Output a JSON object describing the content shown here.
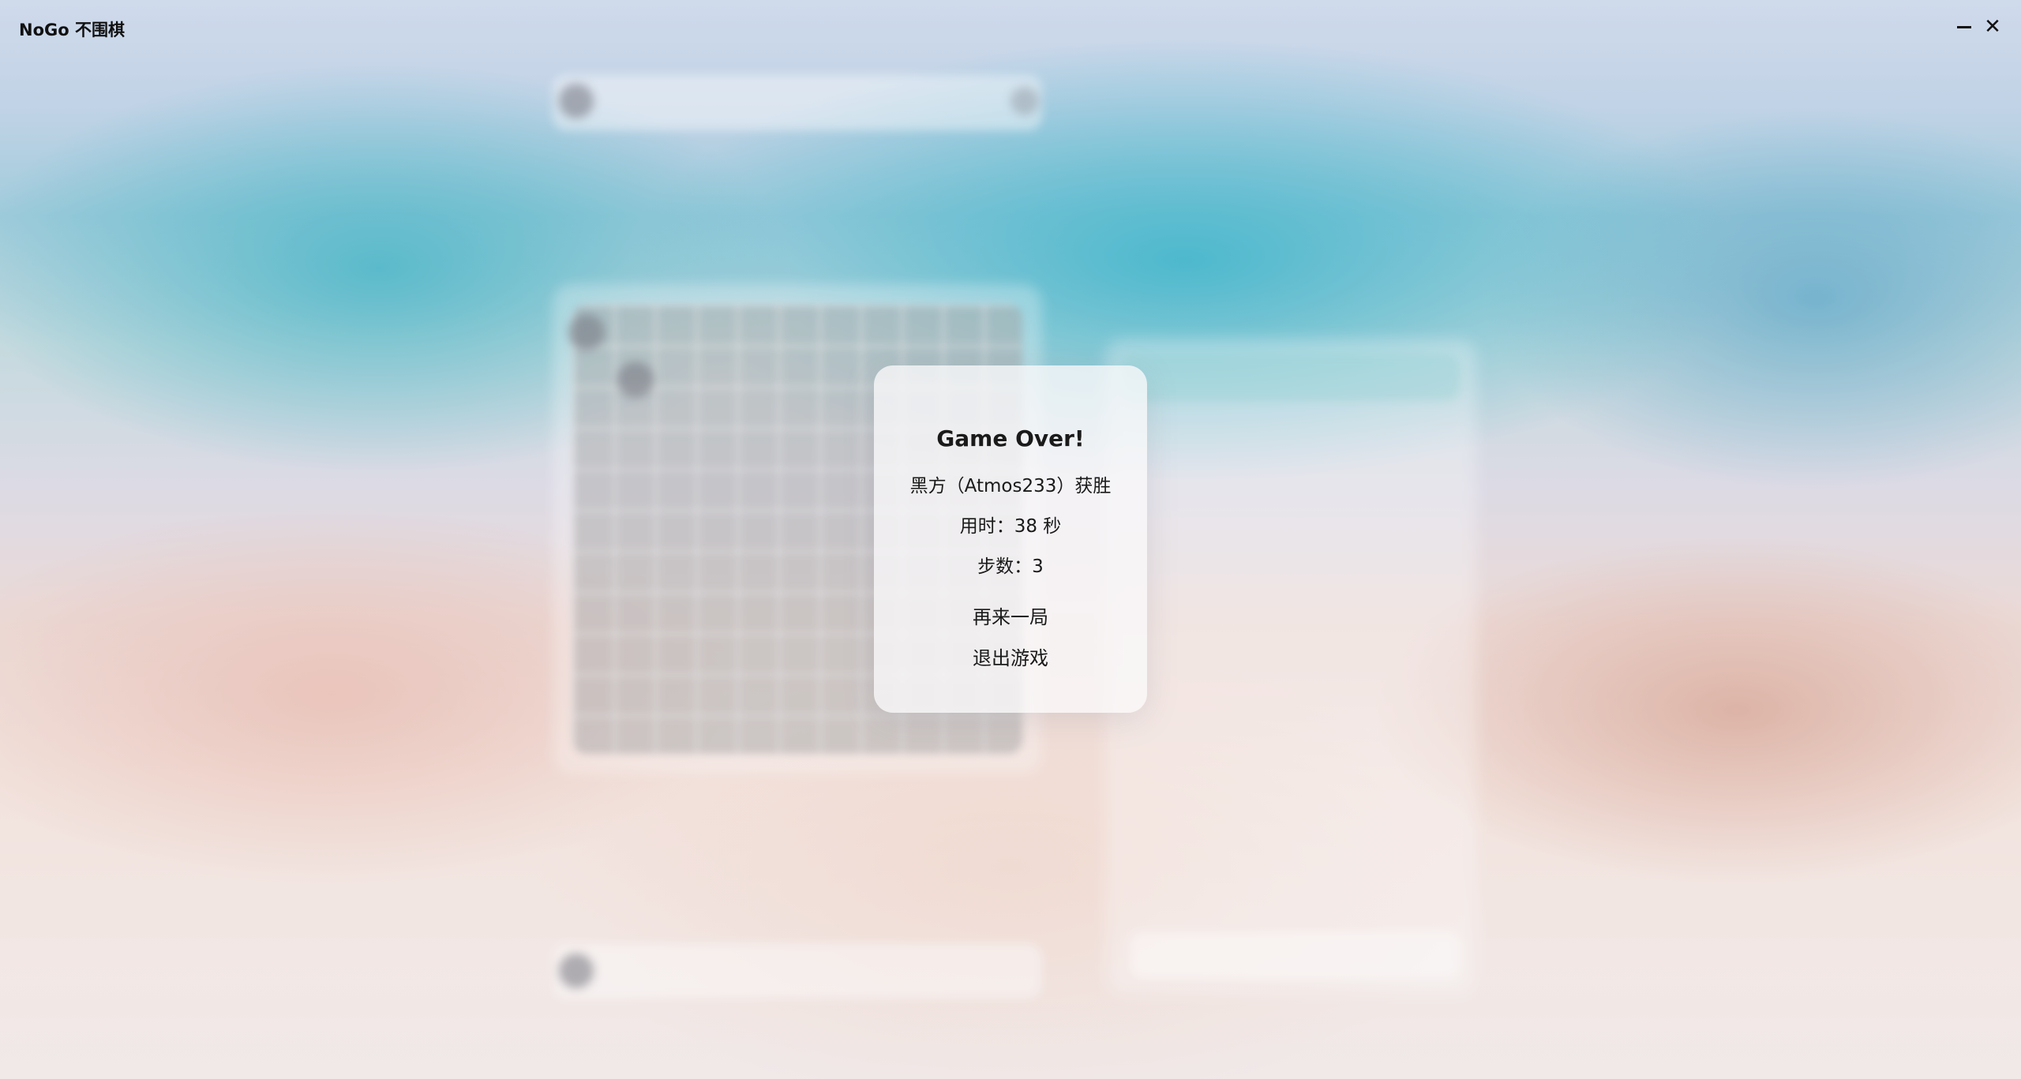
{
  "window": {
    "title": "NoGo 不围棋"
  },
  "dialog": {
    "title": "Game Over!",
    "winner_text": "黑方（Atmos233）获胜",
    "time_text": "用时：38 秒",
    "steps_text": "步数：3",
    "restart_label": "再来一局",
    "quit_label": "退出游戏"
  },
  "icons": {
    "minimize": "minimize-icon",
    "close": "close-icon"
  },
  "colors": {
    "dialog_bg": "#f8f7f9",
    "text": "#1a1a1a"
  }
}
